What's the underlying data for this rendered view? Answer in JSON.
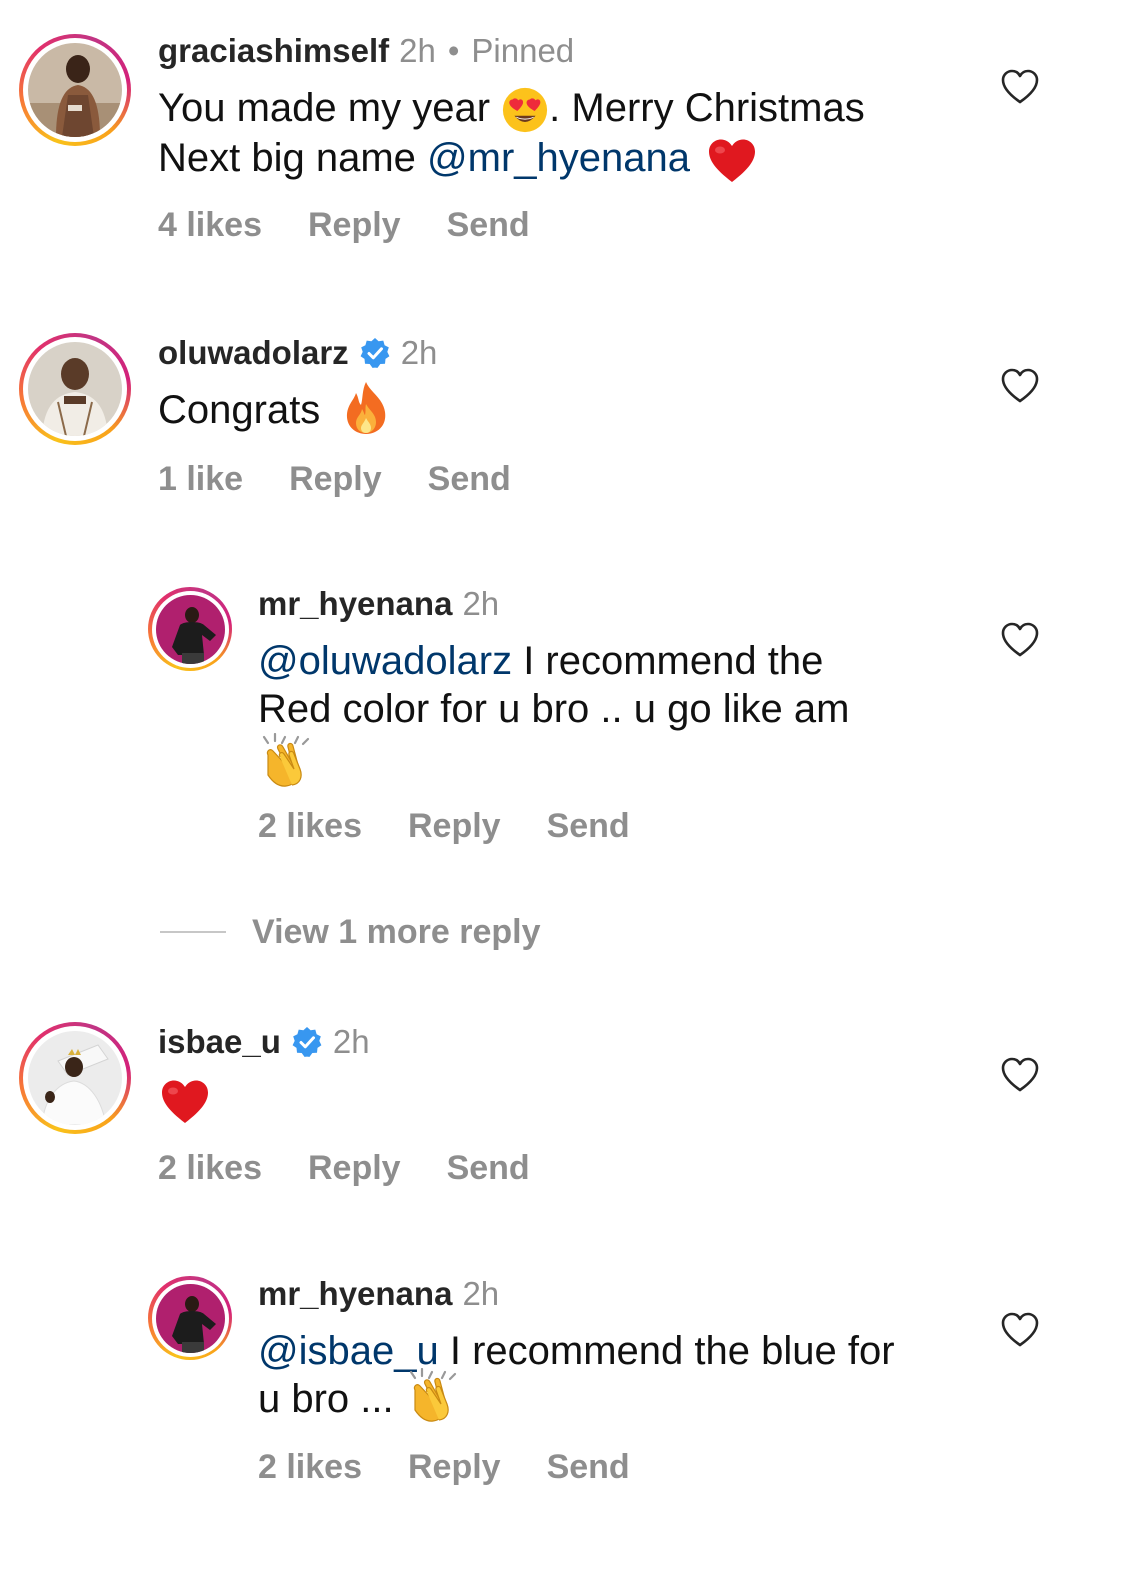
{
  "comments": [
    {
      "username": "graciashimself",
      "time": "2h",
      "separator": "•",
      "pinned": "Pinned",
      "text_part1": "You made my year",
      "emoji1": "heart-eyes-emoji",
      "text_part2": ". Merry Christmas",
      "text_part3": "Next big name",
      "mention": "@mr_hyenana",
      "emoji2": "red-heart-emoji",
      "likes": "4 likes",
      "reply": "Reply",
      "send": "Send"
    },
    {
      "username": "oluwadolarz",
      "verified": true,
      "time": "2h",
      "text": "Congrats",
      "emoji": "fire-emoji",
      "likes": "1 like",
      "reply": "Reply",
      "send": "Send"
    },
    {
      "username": "mr_hyenana",
      "time": "2h",
      "mention": "@oluwadolarz",
      "text_part1": "I recommend the",
      "text_part2": "Red color for u bro .. u go like am",
      "emoji": "clapping-hands-emoji",
      "likes": "2 likes",
      "reply": "Reply",
      "send": "Send"
    },
    {
      "username": "isbae_u",
      "verified": true,
      "time": "2h",
      "emoji": "red-heart-emoji",
      "likes": "2 likes",
      "reply": "Reply",
      "send": "Send"
    },
    {
      "username": "mr_hyenana",
      "time": "2h",
      "mention": "@isbae_u",
      "text_part1": "I recommend the blue for",
      "text_part2": "u bro ...",
      "emoji": "clapping-hands-emoji",
      "likes": "2 likes",
      "reply": "Reply",
      "send": "Send"
    }
  ],
  "view_more": "View 1 more reply",
  "colors": {
    "username": "#262626",
    "meta": "#8e8e8e",
    "mention": "#00376b",
    "verified": "#3897f0",
    "heart": "#ee1d3b"
  }
}
